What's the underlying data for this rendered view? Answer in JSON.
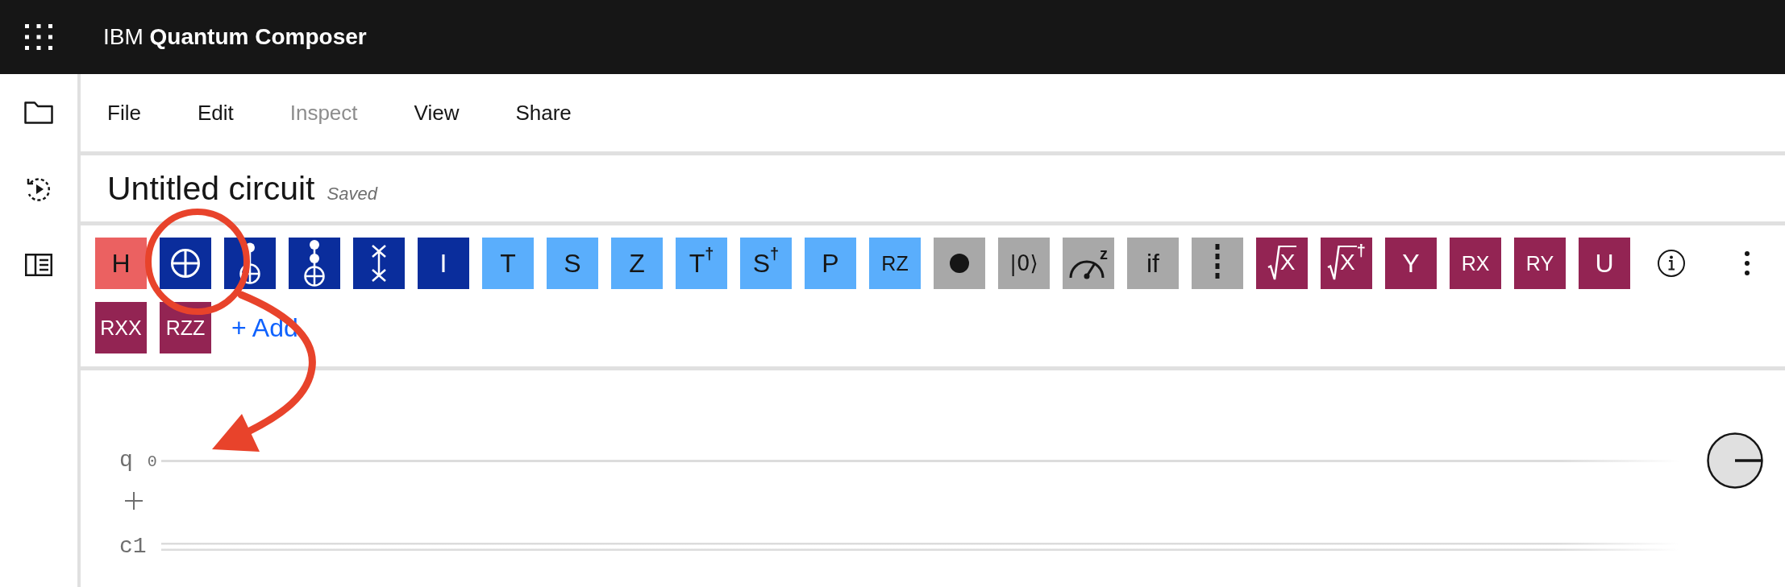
{
  "header": {
    "title": "IBM **Quantum Composer**"
  },
  "menu": [
    {
      "label": "File",
      "disabled": false
    },
    {
      "label": "Edit",
      "disabled": false
    },
    {
      "label": "Inspect",
      "disabled": true
    },
    {
      "label": "View",
      "disabled": false
    },
    {
      "label": "Share",
      "disabled": false
    }
  ],
  "circuit_header": {
    "title": "Untitled circuit",
    "status": "Saved"
  },
  "gates": [
    {
      "kind": "text",
      "label": "H",
      "color": "#eb6161"
    },
    {
      "kind": "target",
      "color": "#0a2d9c"
    },
    {
      "kind": "control_target",
      "color": "#0a2d9c"
    },
    {
      "kind": "double_control_target",
      "color": "#0a2d9c"
    },
    {
      "kind": "swap",
      "color": "#0a2d9c"
    },
    {
      "kind": "text",
      "label": "I",
      "color": "#0a2d9c"
    },
    {
      "kind": "text",
      "label": "T",
      "color": "#5aaefc"
    },
    {
      "kind": "text",
      "label": "S",
      "color": "#5aaefc"
    },
    {
      "kind": "text",
      "label": "Z",
      "color": "#5aaefc"
    },
    {
      "kind": "text",
      "label": "T",
      "superscript": "†",
      "color": "#5aaefc"
    },
    {
      "kind": "text",
      "label": "S",
      "superscript": "†",
      "color": "#5aaefc"
    },
    {
      "kind": "text",
      "label": "P",
      "color": "#5aaefc"
    },
    {
      "kind": "rotation",
      "label": "RZ",
      "color": "#5aaefc"
    },
    {
      "kind": "dot",
      "color": "#a8a8a8"
    },
    {
      "kind": "ket",
      "label": "|0⟩",
      "color": "#a8a8a8"
    },
    {
      "kind": "measure",
      "superscript": "z",
      "color": "#a8a8a8"
    },
    {
      "kind": "text",
      "label": "if",
      "color": "#a8a8a8"
    },
    {
      "kind": "barrier",
      "color": "#a8a8a8"
    },
    {
      "kind": "sqrt",
      "label": "X",
      "color": "#932453"
    },
    {
      "kind": "sqrt",
      "label": "X",
      "superscript": "†",
      "color": "#932453"
    },
    {
      "kind": "text",
      "label": "Y",
      "color": "#932453"
    },
    {
      "kind": "rotation",
      "label": "RX",
      "color": "#932453"
    },
    {
      "kind": "rotation",
      "label": "RY",
      "color": "#932453"
    },
    {
      "kind": "text",
      "label": "U",
      "color": "#932453"
    },
    {
      "kind": "rotation",
      "label": "RXX",
      "color": "#932453"
    },
    {
      "kind": "rotation",
      "label": "RZZ",
      "color": "#932453"
    }
  ],
  "add_link": "+ Add",
  "circuit": {
    "qubits": [
      {
        "register": "q",
        "index": "0"
      }
    ],
    "classical_registers": [
      {
        "name": "c1"
      }
    ]
  }
}
